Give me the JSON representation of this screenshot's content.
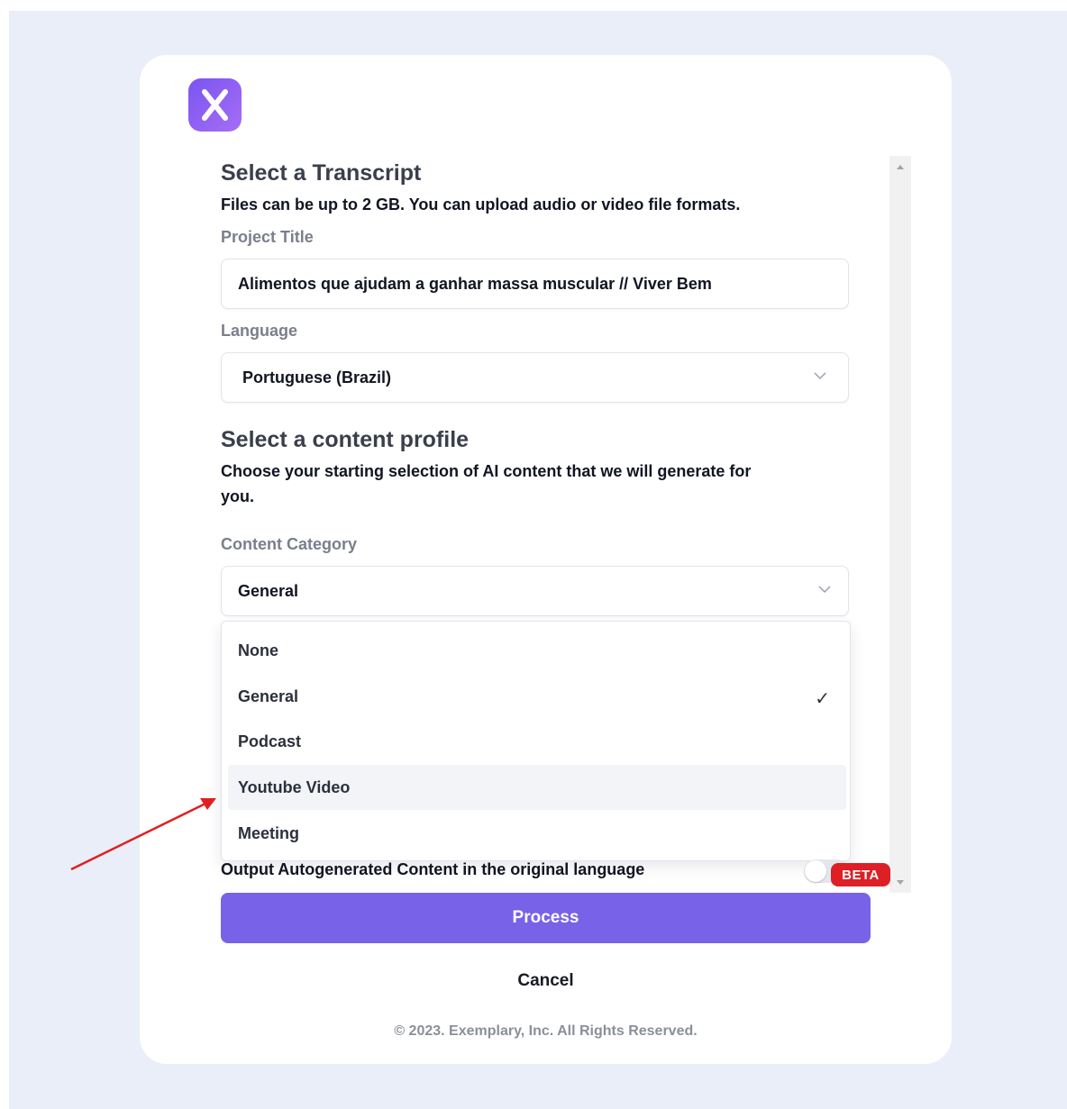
{
  "app": {
    "logo_icon": "x-logo-icon",
    "brand_colors": {
      "accent": "#7862e8",
      "logo_gradient_start": "#7b55f0",
      "logo_gradient_end": "#a56df5",
      "beta": "#de1f26"
    }
  },
  "transcript": {
    "heading": "Select a Transcript",
    "subheading": "Files can be up to 2 GB. You can upload audio or video file formats.",
    "project_title_label": "Project Title",
    "project_title_value": "Alimentos que ajudam a ganhar massa muscular // Viver Bem",
    "language_label": "Language",
    "language_value": "Portuguese (Brazil)"
  },
  "content_profile": {
    "heading": "Select a content profile",
    "subheading_line1": "Choose your starting selection of AI content that we will generate for",
    "subheading_line2": "you.",
    "category_label": "Content Category",
    "category_value": "General",
    "options": [
      {
        "label": "None"
      },
      {
        "label": "General",
        "selected": true
      },
      {
        "label": "Podcast"
      },
      {
        "label": "Youtube Video",
        "hovered": true
      },
      {
        "label": "Meeting"
      }
    ]
  },
  "output": {
    "toggle_label": "Output Autogenerated Content in the original language",
    "toggle_on": false,
    "badge": "BETA"
  },
  "actions": {
    "process": "Process",
    "cancel": "Cancel"
  },
  "footer": {
    "copyright": "© 2023. Exemplary, Inc. All Rights Reserved."
  }
}
